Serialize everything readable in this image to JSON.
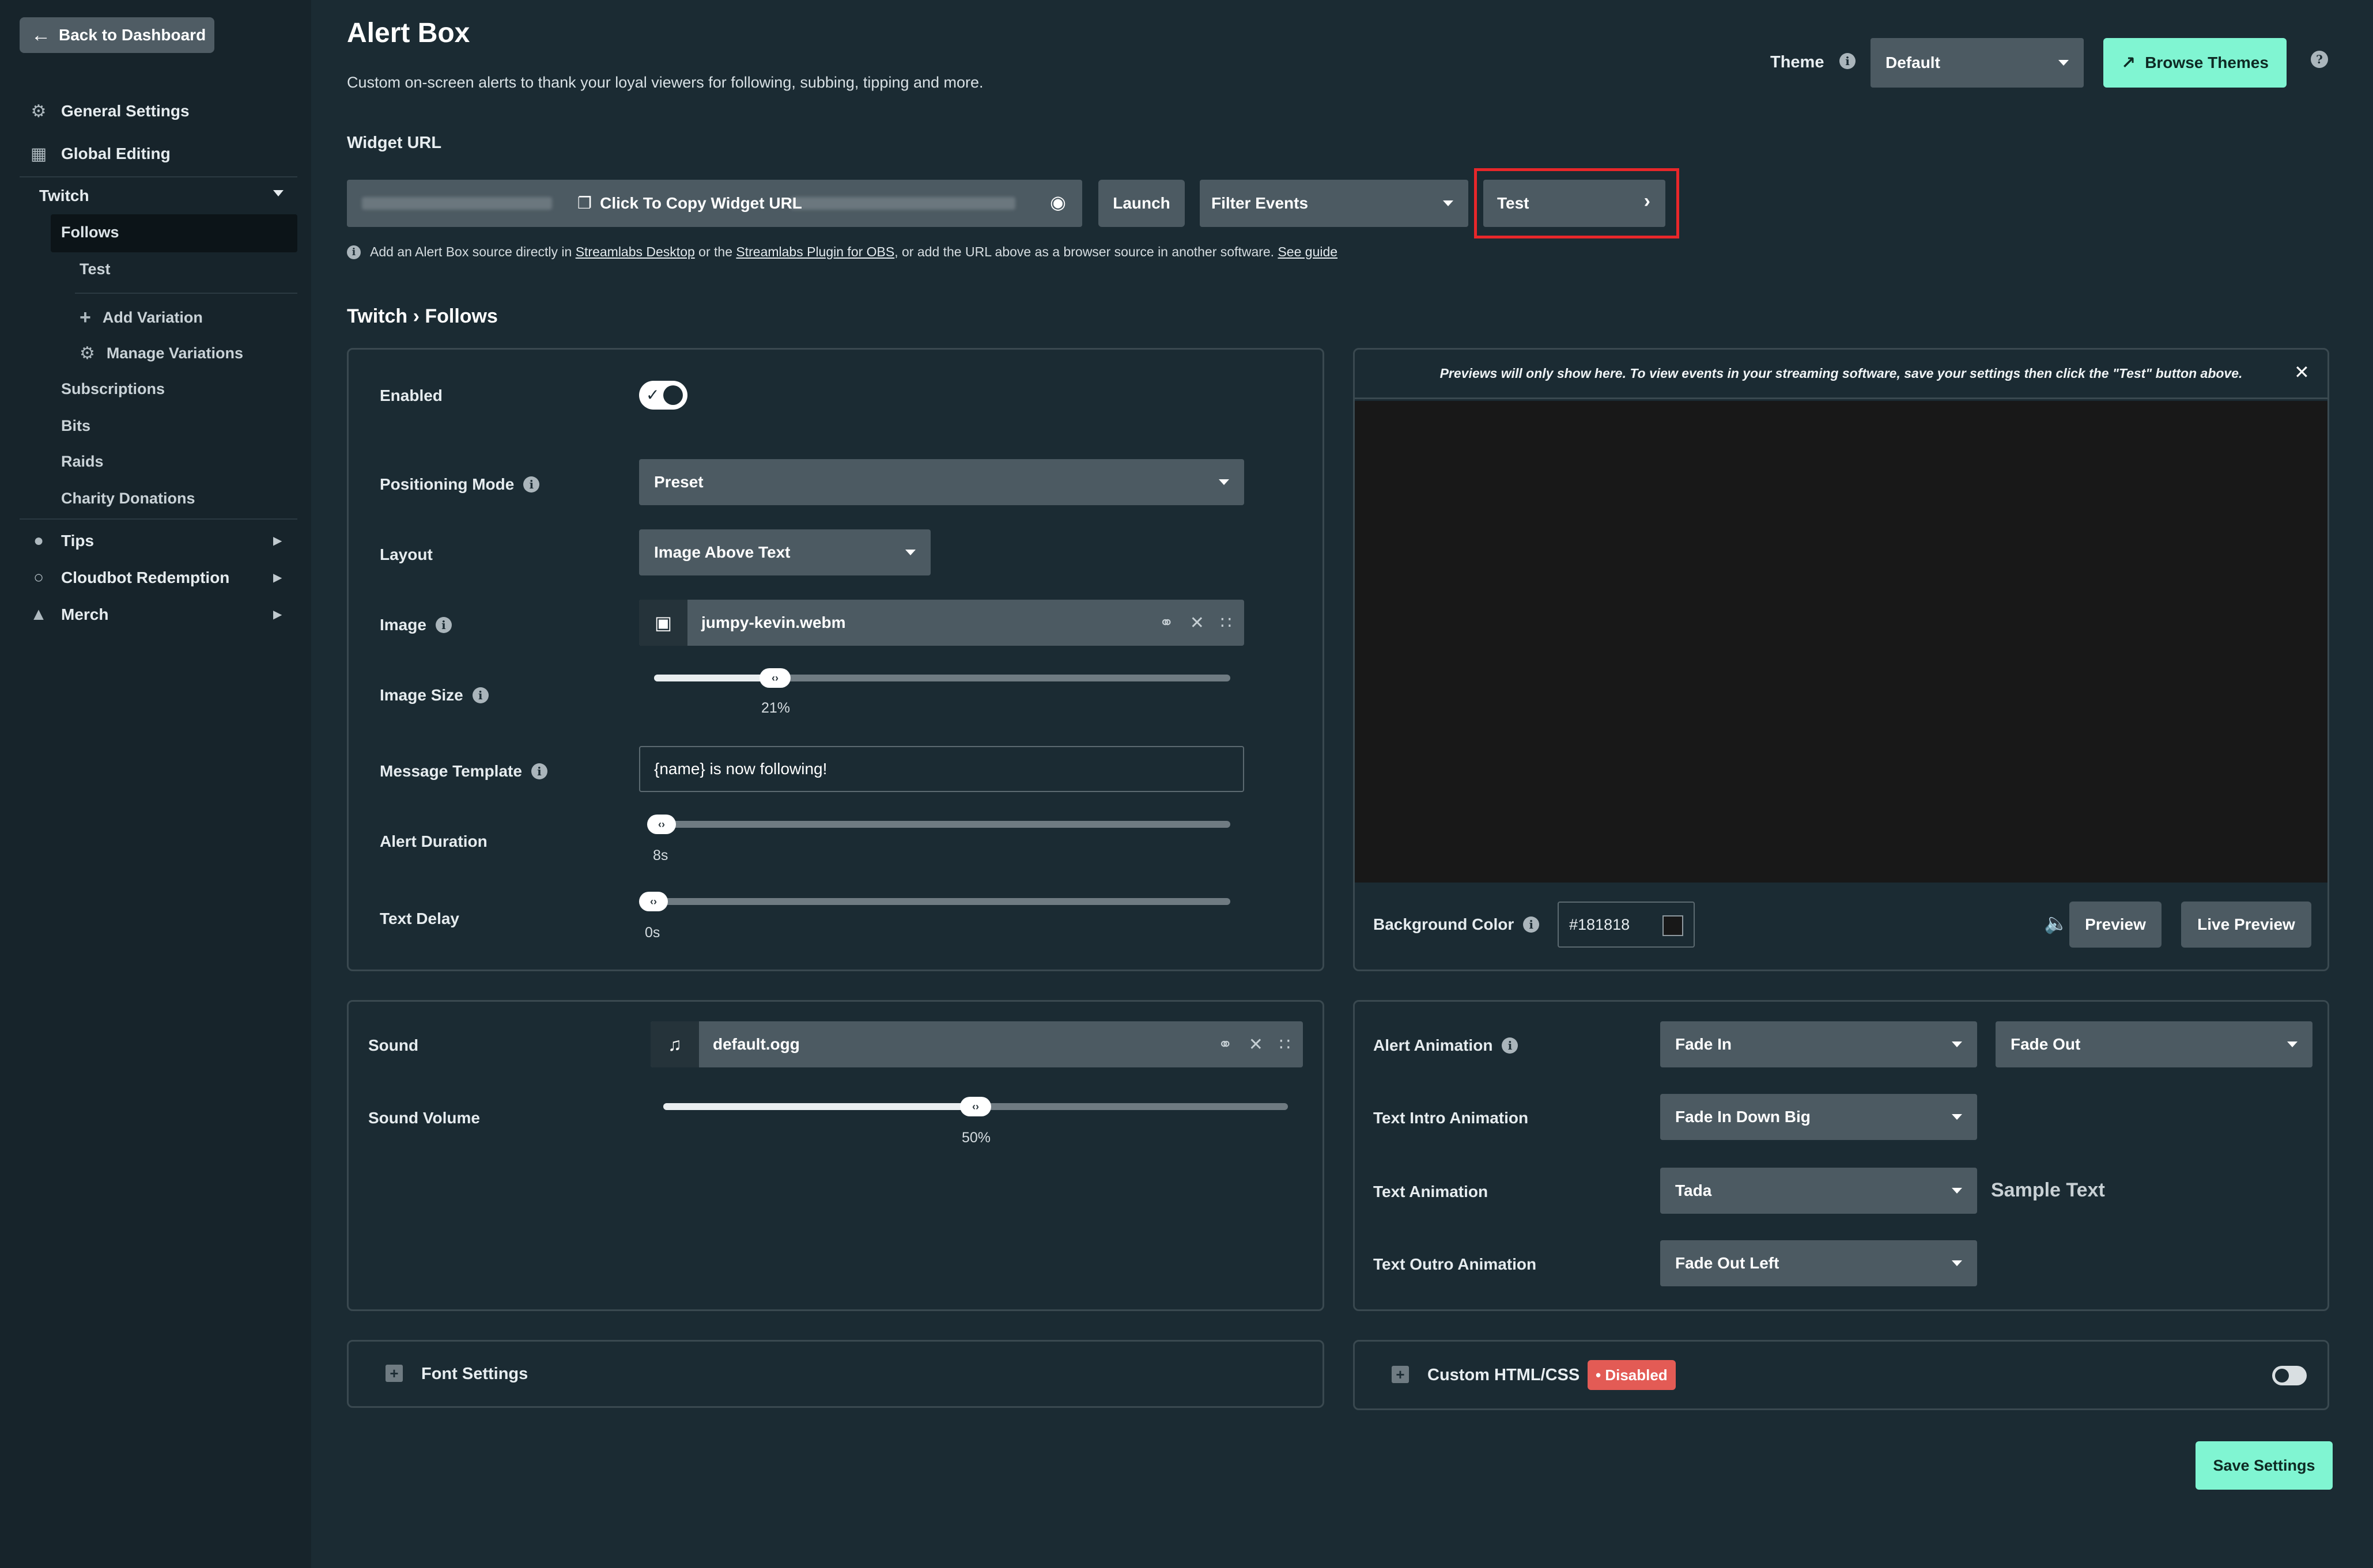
{
  "sidebar": {
    "back_label": "Back to Dashboard",
    "general_settings": "General Settings",
    "global_editing": "Global Editing",
    "twitch": "Twitch",
    "follows": "Follows",
    "test": "Test",
    "add_variation": "Add Variation",
    "manage_variations": "Manage Variations",
    "subscriptions": "Subscriptions",
    "bits": "Bits",
    "raids": "Raids",
    "charity_donations": "Charity Donations",
    "tips": "Tips",
    "cloudbot_redemption": "Cloudbot Redemption",
    "merch": "Merch"
  },
  "header": {
    "title": "Alert Box",
    "subtitle": "Custom on-screen alerts to thank your loyal viewers for following, subbing, tipping and more.",
    "theme_label": "Theme",
    "theme_value": "Default",
    "browse_themes": "Browse Themes"
  },
  "widget": {
    "url_label": "Widget URL",
    "copy_label": "Click To Copy Widget URL",
    "launch": "Launch",
    "filter_events": "Filter Events",
    "test": "Test",
    "help_prefix": "Add an Alert Box source directly in",
    "help_link1": "Streamlabs Desktop",
    "help_mid": "or the",
    "help_link2": "Streamlabs Plugin for OBS",
    "help_suffix": ", or add the URL above as a browser source in another software.",
    "help_link3": "See guide"
  },
  "breadcrumb": "Twitch › Follows",
  "settings": {
    "enabled_label": "Enabled",
    "positioning_label": "Positioning Mode",
    "positioning_value": "Preset",
    "layout_label": "Layout",
    "layout_value": "Image Above Text",
    "image_label": "Image",
    "image_file": "jumpy-kevin.webm",
    "image_size_label": "Image Size",
    "image_size_value": "21%",
    "image_size_fraction": 0.21,
    "message_label": "Message Template",
    "message_value": "{name} is now following!",
    "duration_label": "Alert Duration",
    "duration_value": "8s",
    "text_delay_label": "Text Delay",
    "text_delay_value": "0s"
  },
  "preview": {
    "notice": "Previews will only show here. To view events in your streaming software, save your settings then click the \"Test\" button above.",
    "bg_label": "Background Color",
    "bg_value": "#181818",
    "preview_btn": "Preview",
    "live_preview_btn": "Live Preview"
  },
  "sound": {
    "sound_label": "Sound",
    "sound_file": "default.ogg",
    "volume_label": "Sound Volume",
    "volume_value": "50%",
    "volume_fraction": 0.5
  },
  "animation": {
    "alert_label": "Alert Animation",
    "alert_in": "Fade In",
    "alert_out": "Fade Out",
    "intro_label": "Text Intro Animation",
    "intro_value": "Fade In Down Big",
    "text_label": "Text Animation",
    "text_value": "Tada",
    "sample_text": "Sample Text",
    "outro_label": "Text Outro Animation",
    "outro_value": "Fade Out Left"
  },
  "font_settings": "Font Settings",
  "custom_html": {
    "label": "Custom HTML/CSS",
    "badge": "• Disabled"
  },
  "save": "Save Settings",
  "colors": {
    "accent": "#80f5d2",
    "highlight": "#e8272a",
    "disabled_badge": "#e35b55"
  }
}
